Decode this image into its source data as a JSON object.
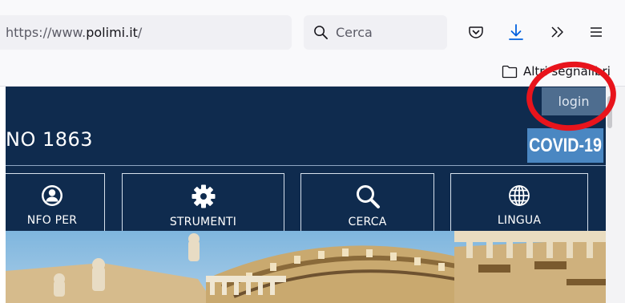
{
  "browser": {
    "url_prefix": "https://www.",
    "url_host": "polimi.it",
    "url_suffix": "/",
    "search_placeholder": "Cerca",
    "icons": [
      "pocket-icon",
      "download-icon",
      "overflow-chevrons-icon",
      "menu-icon"
    ],
    "bookmarks_folder": "Altri segnalibri"
  },
  "site": {
    "login_label": "login",
    "title_fragment": "NO 1863",
    "covid_label": "COVID-19",
    "nav": [
      {
        "label": "NFO PER",
        "icon": "user-circle-icon"
      },
      {
        "label": "STRUMENTI",
        "icon": "gear-icon"
      },
      {
        "label": "CERCA",
        "icon": "search-icon"
      },
      {
        "label": "LINGUA",
        "icon": "globe-icon"
      }
    ]
  },
  "colors": {
    "header_navy": "#0f2b4e",
    "login_bg": "#4e6d8f",
    "covid_bg": "#4a87c2",
    "annotation_red": "#e8141c"
  }
}
